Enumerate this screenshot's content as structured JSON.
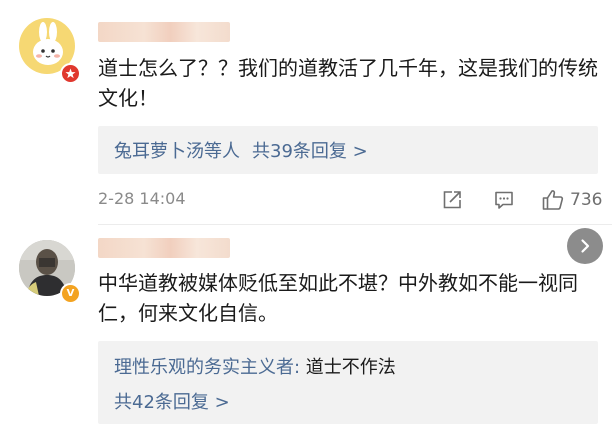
{
  "colors": {
    "link": "#4b6a93",
    "meta": "#8a8a8a",
    "reply_bg": "#f2f2f2",
    "badge_red": "#e0382e",
    "badge_orange": "#f3a321"
  },
  "comments": [
    {
      "username": "",
      "avatar_icon": "cartoon-rabbit-avatar",
      "badge_icon": "star-badge-icon",
      "text": "道士怎么了？？我们的道教活了几千年，这是我们的传统文化！",
      "replies": {
        "names": "兔耳萝卜汤等人",
        "count_label": "共39条回复 >"
      },
      "timestamp": "2-28 14:04",
      "actions": {
        "share_icon": "share-icon",
        "comment_icon": "comment-icon",
        "like_icon": "thumbs-up-icon",
        "likes": "736"
      }
    },
    {
      "username": "",
      "avatar_icon": "photo-avatar",
      "badge_icon": "verified-v-badge-icon",
      "badge_text": "V",
      "text": "中华道教被媒体贬低至如此不堪？中外教如不能一视同仁，何来文化自信。",
      "replies": {
        "preview_author": "理性乐观的务实主义者:",
        "preview_text": " 道士不作法",
        "count_label": "共42条回复 >"
      }
    }
  ],
  "nav": {
    "next_icon": "chevron-right-icon"
  }
}
